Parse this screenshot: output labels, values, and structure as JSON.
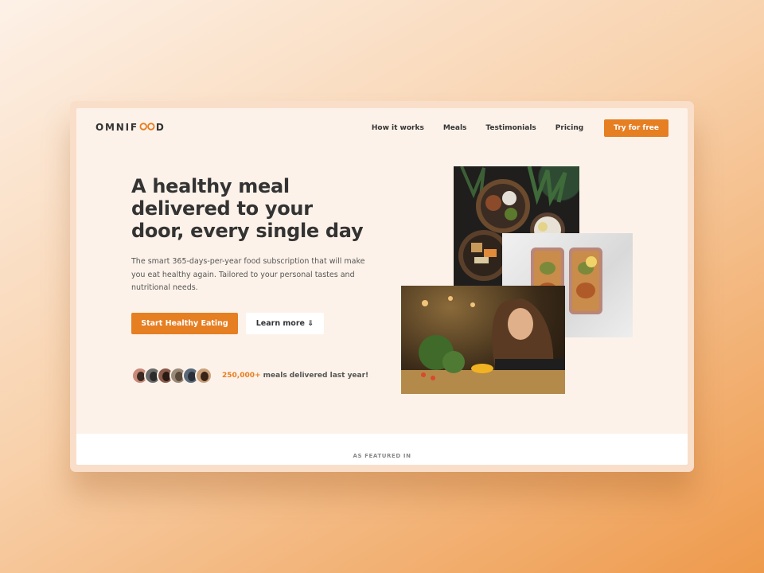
{
  "header": {
    "logo_prefix": "OMNIF",
    "logo_suffix": "D",
    "logo_mark_icon": "infinity-icon",
    "nav": [
      {
        "label": "How it works"
      },
      {
        "label": "Meals"
      },
      {
        "label": "Testimonials"
      },
      {
        "label": "Pricing"
      }
    ],
    "cta_label": "Try for free"
  },
  "hero": {
    "title": "A healthy meal delivered to your door, every single day",
    "description": "The smart 365-days-per-year food subscription that will make you eat healthy again. Tailored to your personal tastes and nutritional needs.",
    "primary_button": "Start Healthy Eating",
    "secondary_button": "Learn more ⇓",
    "delivered_count": "250,000+",
    "delivered_text": " meals delivered last year!"
  },
  "featured": {
    "label": "AS FEATURED IN"
  },
  "colors": {
    "accent": "#e67e22",
    "text": "#333333",
    "background": "#fdf2e9"
  }
}
